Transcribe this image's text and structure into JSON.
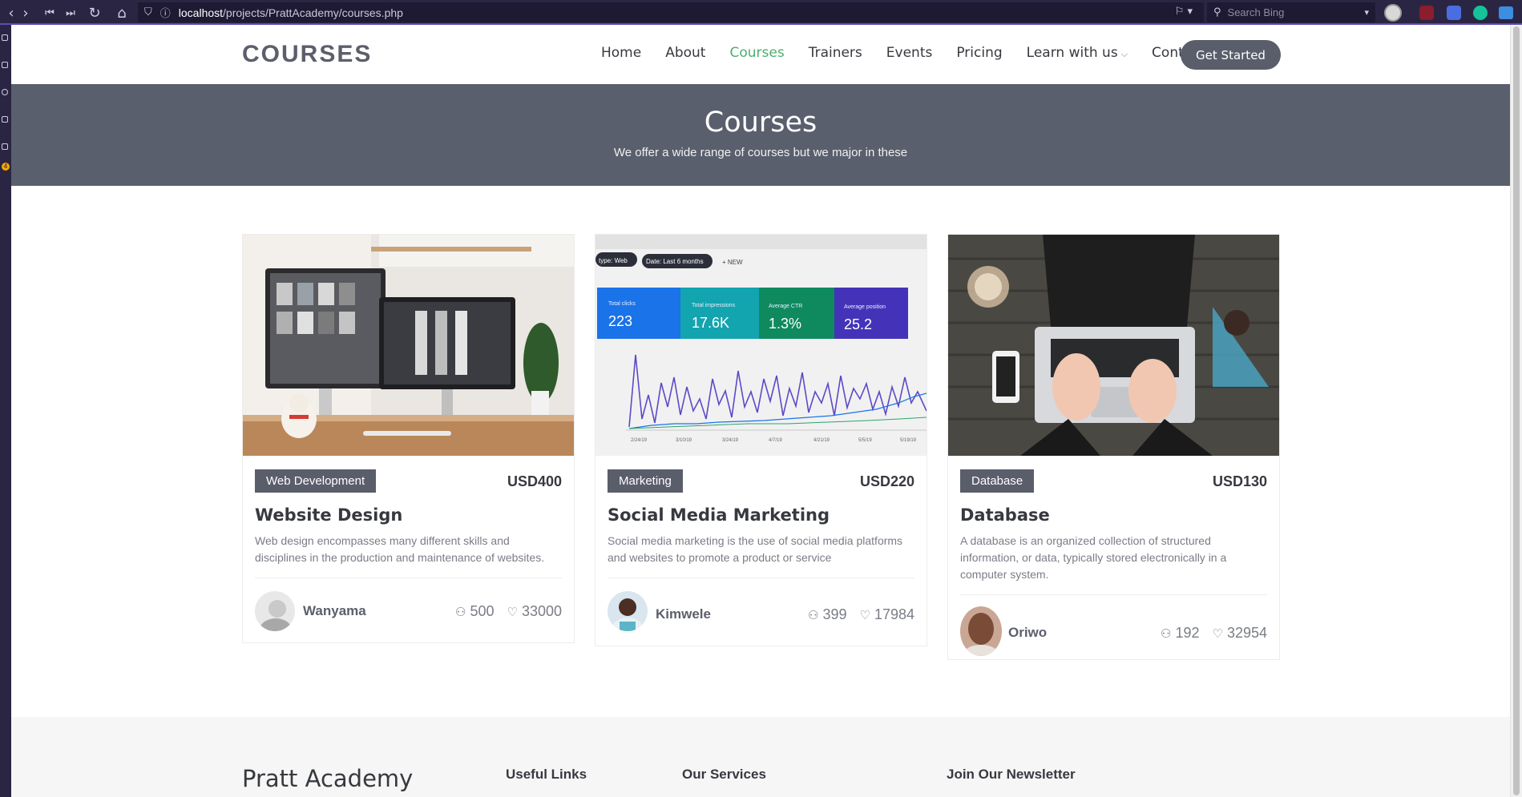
{
  "browser": {
    "url_host": "localhost",
    "url_path": "/projects/PrattAcademy/courses.php",
    "search_placeholder": "Search Bing"
  },
  "header": {
    "logo": "COURSES",
    "nav": [
      "Home",
      "About",
      "Courses",
      "Trainers",
      "Events",
      "Pricing",
      "Learn with us",
      "Contact"
    ],
    "active_nav": "Courses",
    "cta": "Get Started"
  },
  "hero": {
    "title": "Courses",
    "subtitle": "We offer a wide range of courses but we major in these"
  },
  "courses": [
    {
      "category": "Web Development",
      "price": "USD400",
      "title": "Website Design",
      "description": "Web design encompasses many different skills and disciplines in the production and maintenance of websites.",
      "trainer": "Wanyama",
      "students": "500",
      "likes": "33000"
    },
    {
      "category": "Marketing",
      "price": "USD220",
      "title": "Social Media Marketing",
      "description": "Social media marketing is the use of social media platforms and websites to promote a product or service",
      "trainer": "Kimwele",
      "students": "399",
      "likes": "17984"
    },
    {
      "category": "Database",
      "price": "USD130",
      "title": "Database",
      "description": "A database is an organized collection of structured information, or data, typically stored electronically in a computer system.",
      "trainer": "Oriwo",
      "students": "192",
      "likes": "32954"
    }
  ],
  "analytics_image": {
    "filters": [
      "type: Web",
      "Date: Last 6 months",
      "+ NEW"
    ],
    "kpis": [
      {
        "label": "Total clicks",
        "value": "223"
      },
      {
        "label": "Total impressions",
        "value": "17.6K"
      },
      {
        "label": "Average CTR",
        "value": "1.3%"
      },
      {
        "label": "Average position",
        "value": "25.2"
      }
    ],
    "dates": [
      "2/24/19",
      "3/10/19",
      "3/24/19",
      "4/7/19",
      "4/21/19",
      "5/5/19",
      "5/19/19"
    ]
  },
  "footer": {
    "brand": "Pratt Academy",
    "useful_links": "Useful Links",
    "services": "Our Services",
    "newsletter": "Join Our Newsletter"
  },
  "colors": {
    "accent_green": "#4cae6e",
    "hero_bg": "#5a5f6d",
    "tag_bg": "#5a5d6a",
    "browser_bg": "#2b2544"
  }
}
